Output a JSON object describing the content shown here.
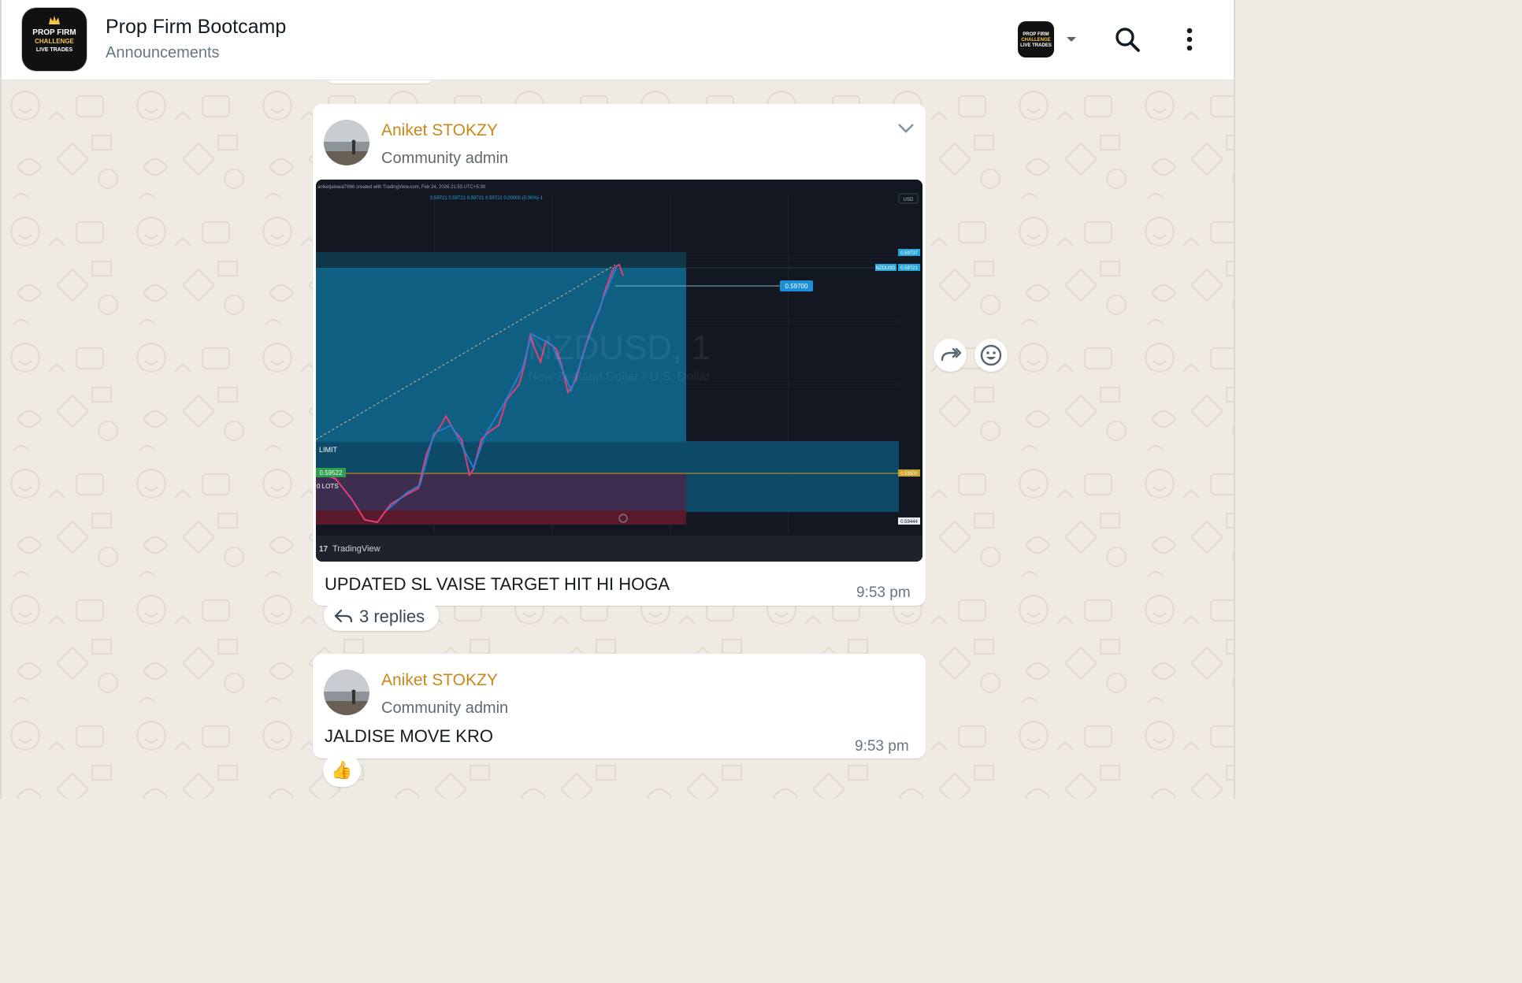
{
  "header": {
    "group_name": "Prop Firm Bootcamp",
    "subtitle": "Announcements",
    "logo": {
      "line1": "PROP FIRM",
      "line2": "CHALLENGE",
      "line3": "LIVE TRADES"
    }
  },
  "messages": [
    {
      "sender": "Aniket STOKZY",
      "role": "Community admin",
      "text": "UPDATED SL VAISE TARGET HIT HI HOGA",
      "time": "9:53 pm",
      "replies_label": "3 replies",
      "chart": {
        "header_line": "aniketjaiswal7666 created with TradingView.com, Feb 24, 2026 21:53 UTC+5:30",
        "ohlc_line": "0.59721   0.59721   0.59721   0.59721   0.00000 (0.00%)   1",
        "currency": "USD",
        "watermark_symbol": "NZDUSD, 1",
        "watermark_name": "New Zealand Dollar / U.S. Dollar",
        "target_label": "0.59700",
        "price_top": "0.59737",
        "symbol_tag": "NZDUSD",
        "symbol_price": "0.59721",
        "entry_price": "0.59522",
        "entry_axis": "0.59500",
        "stop_axis": "0.59444",
        "limit_label": "LIMIT",
        "lots_label": "0 LOTS",
        "brand": "TradingView"
      }
    },
    {
      "sender": "Aniket STOKZY",
      "role": "Community admin",
      "text": "JALDISE MOVE KRO",
      "time": "9:53 pm",
      "reaction": "👍"
    }
  ],
  "colors": {
    "sender_name": "#c88719",
    "chat_background": "#efeae2",
    "chart_background": "#131722",
    "profit_zone": "#0e5f82",
    "loss_zone": "#3d2d4e"
  },
  "icons": [
    "caret-down-icon",
    "search-icon",
    "more-vertical-icon",
    "chevron-down-icon",
    "reply-icon",
    "forward-icon",
    "emoji-icon",
    "thumbs-up-icon"
  ]
}
